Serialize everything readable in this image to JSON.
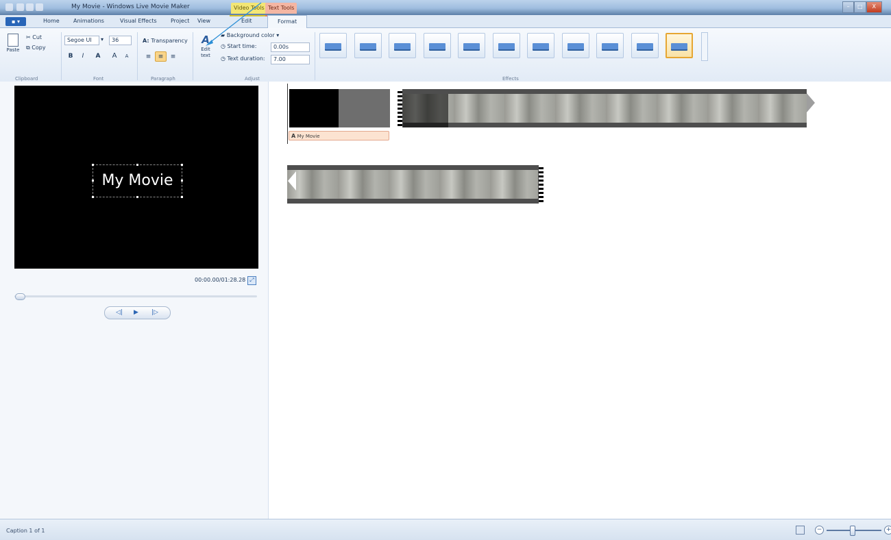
{
  "window": {
    "title": "My Movie - Windows Live Movie Maker",
    "context_tabs": [
      "Video Tools",
      "Text Tools"
    ],
    "min_label": "–",
    "max_label": "□",
    "close_label": "X"
  },
  "tabs": {
    "app_menu_label": "▪ ▾",
    "items": [
      "Home",
      "Animations",
      "Visual Effects",
      "Project",
      "View",
      "Edit"
    ],
    "active": "Format"
  },
  "ribbon": {
    "clipboard": {
      "paste": "Paste",
      "cut": "Cut",
      "copy": "Copy",
      "label": "Clipboard"
    },
    "font": {
      "family": "Segoe UI",
      "size": "36",
      "bold": "B",
      "italic": "I",
      "color": "A",
      "grow": "A",
      "shrink": "A",
      "label": "Font"
    },
    "paragraph": {
      "transparency": "Transparency",
      "label": "Paragraph"
    },
    "adjust": {
      "edit_text": [
        "Edit",
        "text"
      ],
      "background_color": "Background color",
      "start_time_label": "Start time:",
      "start_time_value": "0.00s",
      "text_duration_label": "Text duration:",
      "text_duration_value": "7.00",
      "label": "Adjust"
    },
    "effects": {
      "label": "Effects",
      "count": 11,
      "selected_index": 10
    }
  },
  "preview": {
    "caption": "My Movie",
    "timecode": "00:00.00/01:28.28",
    "seek_position": 0.0
  },
  "storyboard": {
    "title_clip_caption": "My Movie"
  },
  "status": {
    "text": "Caption 1 of 1"
  },
  "colors": {
    "accent": "#2865b8",
    "video_tools": "#f3e675",
    "text_tools": "#f4b6a3",
    "selected_effect": "#e6a632",
    "caption_fill": "#fce3d1"
  }
}
